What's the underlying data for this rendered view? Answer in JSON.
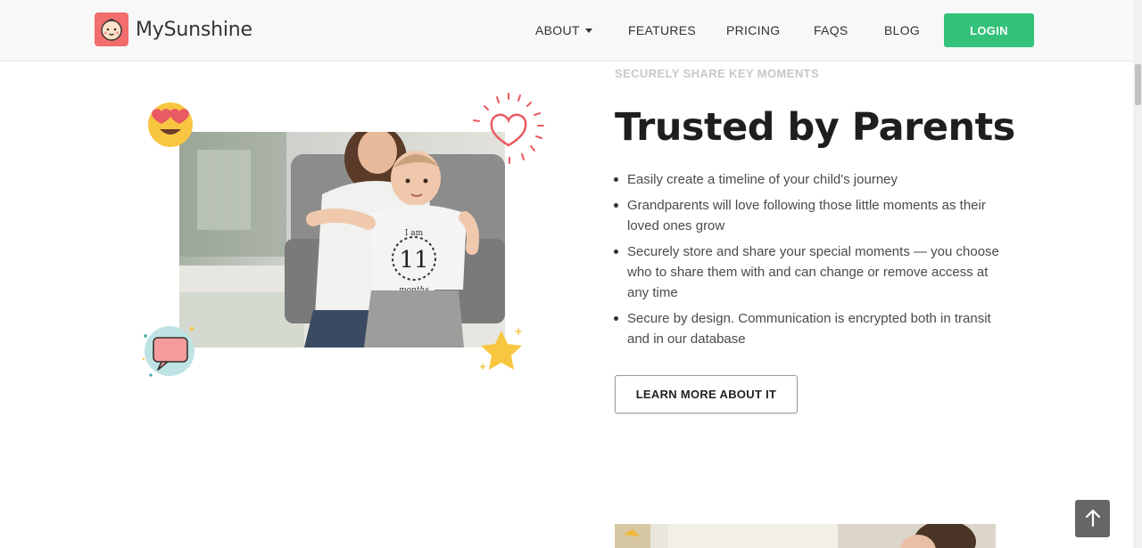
{
  "brand": {
    "name": "MySunshine",
    "logo_icon": "baby-face-icon"
  },
  "nav": {
    "items": [
      {
        "label": "ABOUT",
        "has_dropdown": true
      },
      {
        "label": "FEATURES"
      },
      {
        "label": "PRICING"
      },
      {
        "label": "FAQS"
      },
      {
        "label": "BLOG"
      }
    ],
    "login_label": "LOGIN"
  },
  "section": {
    "eyebrow": "SECURELY SHARE KEY MOMENTS",
    "title": "Trusted by Parents",
    "bullets": [
      "Easily create a timeline of your child's journey",
      "Grandparents will love following those little moments as their loved ones grow",
      "Securely store and share your special moments — you choose who to share them with and can change or remove access at any time",
      "Secure by design. Communication is encrypted both in transit and in our database"
    ],
    "cta_label": "LEARN MORE ABOUT IT",
    "photo_shirt_text": [
      "I am",
      "11",
      "months"
    ]
  },
  "colors": {
    "accent": "#34c27a",
    "brand": "#f26d6d",
    "heading": "#1e1e1e",
    "eyebrow": "#c8c8c8"
  },
  "decorations": [
    "heart-eyes-emoji-icon",
    "heart-icon",
    "chat-bubble-icon",
    "star-icon"
  ],
  "back_to_top_icon": "arrow-up-icon"
}
